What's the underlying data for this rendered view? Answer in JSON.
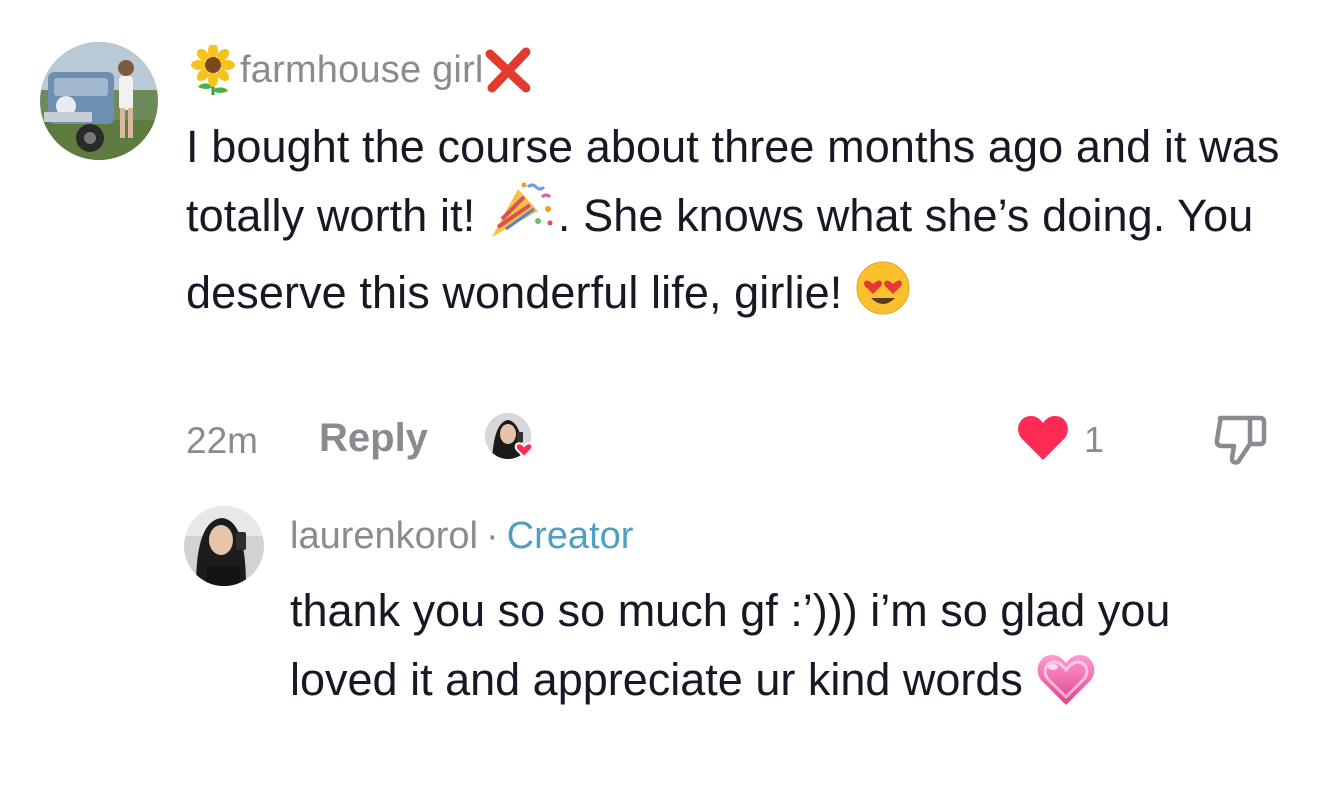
{
  "comment": {
    "username": "farmhouse girl",
    "username_prefix_emoji": "sunflower-emoji",
    "username_suffix_emoji": "cross-mark-emoji",
    "text_part1": "I bought the course about three months ago and it was totally worth it! ",
    "text_emoji1": "party-popper-emoji",
    "text_part2": ". She knows what she’s doing. You deserve this wonderful life, girlie! ",
    "text_emoji2": "heart-eyes-emoji",
    "time": "22m",
    "reply_label": "Reply",
    "like_count": "1",
    "liked_by_creator": true
  },
  "reply": {
    "username": "laurenkorol",
    "separator": "·",
    "badge": "Creator",
    "text": "thank you so so much gf :’))) i’m so glad you loved it and appreciate ur kind words ",
    "text_emoji": "pink-heart-emoji"
  },
  "colors": {
    "primary_text": "#161823",
    "secondary_text": "#8a8b91",
    "creator_blue": "#4f9fc4",
    "like_red": "#fe2c55"
  }
}
